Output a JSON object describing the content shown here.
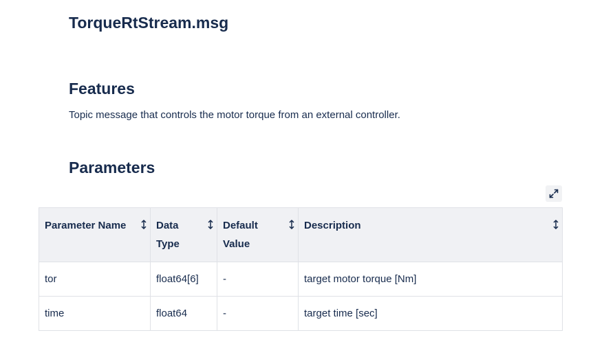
{
  "page": {
    "title": "TorqueRtStream.msg"
  },
  "features": {
    "heading": "Features",
    "text": "Topic message that controls the motor torque from an external controller."
  },
  "parameters": {
    "heading": "Parameters",
    "expand_icon": "expand-diagonal-arrows",
    "sort_icon": "up-down-arrow",
    "columns": [
      {
        "label": "Parameter Name"
      },
      {
        "label": "Data Type"
      },
      {
        "label": "Default Value"
      },
      {
        "label": "Description"
      }
    ],
    "rows": [
      {
        "name": "tor",
        "type": "float64[6]",
        "default": "-",
        "description": "target motor torque [Nm]"
      },
      {
        "name": "time",
        "type": "float64",
        "default": "-",
        "description": "target time [sec]"
      }
    ]
  },
  "colors": {
    "text": "#172b4d",
    "header_bg": "#f0f1f4",
    "border": "#dfe1e6",
    "button_bg": "#f1f2f4"
  }
}
